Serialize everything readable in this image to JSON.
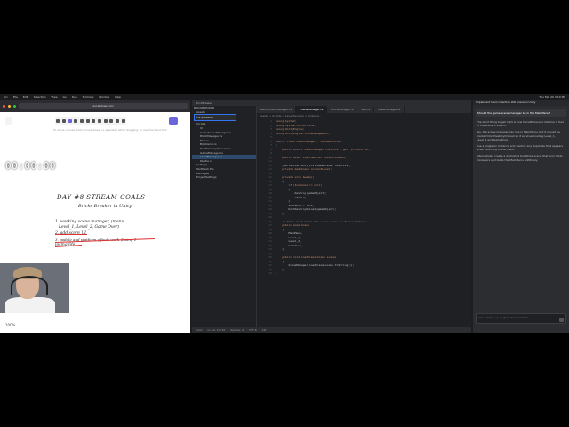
{
  "menubar": {
    "app": "Arc",
    "items": [
      "File",
      "Edit",
      "Selection",
      "View",
      "Go",
      "Run",
      "Terminal",
      "Window",
      "Help"
    ],
    "clock": "Thu Feb 20 3:19 PM"
  },
  "browser": {
    "url": "excalidraw.com",
    "hint": "To move canvas, hold mouse wheel or spacebar while dragging, or use the hand tool"
  },
  "whiteboard": {
    "title": "DAY #8 STREAM GOALS",
    "subtitle": "Bricks Breaker in Unity",
    "lines": [
      "1. working scene manager, (menu,",
      "Level_1, Level_2, Game Over)",
      "2. add score UI",
      "3. paddle and platform effects work (losing 1",
      "losing life)"
    ],
    "zoom": "100%"
  },
  "timer": "00:00:00",
  "ide": {
    "title": "BrickBreaker",
    "tabs": [
      "GameSceneManager.cs",
      "SceneManager.cs",
      "BlockManager.cs",
      "Ball.cs",
      "LevelManager.cs"
    ],
    "breadcrumb": "Assets > Scripts > LevelManager > Instance",
    "search": "currentLevel",
    "tree": [
      "BRICKBREAKER",
      "Assets",
      "Prefabs",
      "Scenes",
      "Scripts",
      "UI",
      "GameSceneManager.cs",
      "BlockManager.cs",
      "Ball.cs",
      "BlockGrid.cs",
      "DontDestroyOnLoad.cs",
      "GameManager.cs",
      "LevelManager.cs",
      "Paddle.cs",
      "Settings",
      "TextMesh Pro",
      "Packages",
      "ProjectSettings"
    ],
    "tree_selected": 12,
    "code": [
      "using System;",
      "using System.Collections;",
      "using UnityEngine;",
      "using UnityEngine.SceneManagement;",
      "",
      "public class LevelManager : MonoBehaviour",
      "{",
      "    public static LevelManager Instance { get; private set; }",
      "",
      "    public event EventHandler OnLevelLoaded;",
      "",
      "    [SerializeField] List<GameScene> levelList;",
      "    private GameScene currentLevel;",
      "",
      "    private void Awake()",
      "    {",
      "        if (Instance != null)",
      "        {",
      "            Destroy(gameObject);",
      "            return;",
      "        }",
      "        Instance = this;",
      "        DontDestroyOnLoad(gameObject);",
      "    }",
      "",
      "    // Names must match the scene names in Build Settings",
      "    public enum Scene",
      "    {",
      "        MainMenu,",
      "        Level_1,",
      "        Level_2,",
      "        GameOver,",
      "    }",
      "",
      "    public void LoadScene(Scene scene)",
      "    {",
      "        SceneManager.LoadScene(scene.ToString());",
      "    }",
      "}"
    ],
    "status_left": "main",
    "status_items": [
      "Ln 12, Col 25",
      "Spaces: 4",
      "UTF-8",
      "C#"
    ]
  },
  "chat": {
    "header": "Implement load collection still scene in Unity",
    "question": "Should the game scene manager be in the MainMenu?",
    "answer": [
      "The short thing to get right is how MonoBehaviour lifetime is tied to the scene it lives in.",
      "Yes, the scene manager can live in MainMenu, but it should be marked DontDestroyOnLoad so it survives loading Level_1, Level_2 and GameOver.",
      "Use a singleton Instance and destroy any duplicate that appears when returning to the menu.",
      "Alternatively create a dedicated bootstrap scene that only holds managers and loads the MainMenu additively."
    ],
    "input_placeholder": "Ask a follow-up or @mention context"
  },
  "colors": {
    "accent": "#6965db",
    "ide_bg": "#1f2023",
    "strike": "#e03131"
  }
}
